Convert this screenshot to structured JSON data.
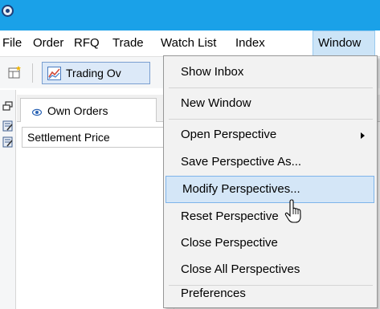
{
  "menubar": {
    "items": [
      {
        "label": "File"
      },
      {
        "label": "Order"
      },
      {
        "label": "RFQ"
      },
      {
        "label": "Trade"
      },
      {
        "label": "Watch List"
      },
      {
        "label": "Index"
      },
      {
        "label": "Window"
      }
    ],
    "active": "Window"
  },
  "toolbar": {
    "perspective_button": "Trading Ov",
    "perspective_icon": "chart-icon"
  },
  "view": {
    "tab_label": "Own Orders",
    "column_header": "Settlement Price"
  },
  "window_menu": {
    "items": [
      {
        "label": "Show Inbox"
      },
      {
        "label": "New Window"
      },
      {
        "label": "Open Perspective",
        "submenu": true
      },
      {
        "label": "Save Perspective As..."
      },
      {
        "label": "Modify Perspectives..."
      },
      {
        "label": "Reset Perspective"
      },
      {
        "label": "Close Perspective"
      },
      {
        "label": "Close All Perspectives"
      },
      {
        "label": "Preferences"
      }
    ],
    "highlighted": "Modify Perspectives..."
  },
  "colors": {
    "title_bar": "#1aa1e8",
    "menu_highlight": "#d4e6f7",
    "menu_highlight_border": "#7eb4ea"
  }
}
